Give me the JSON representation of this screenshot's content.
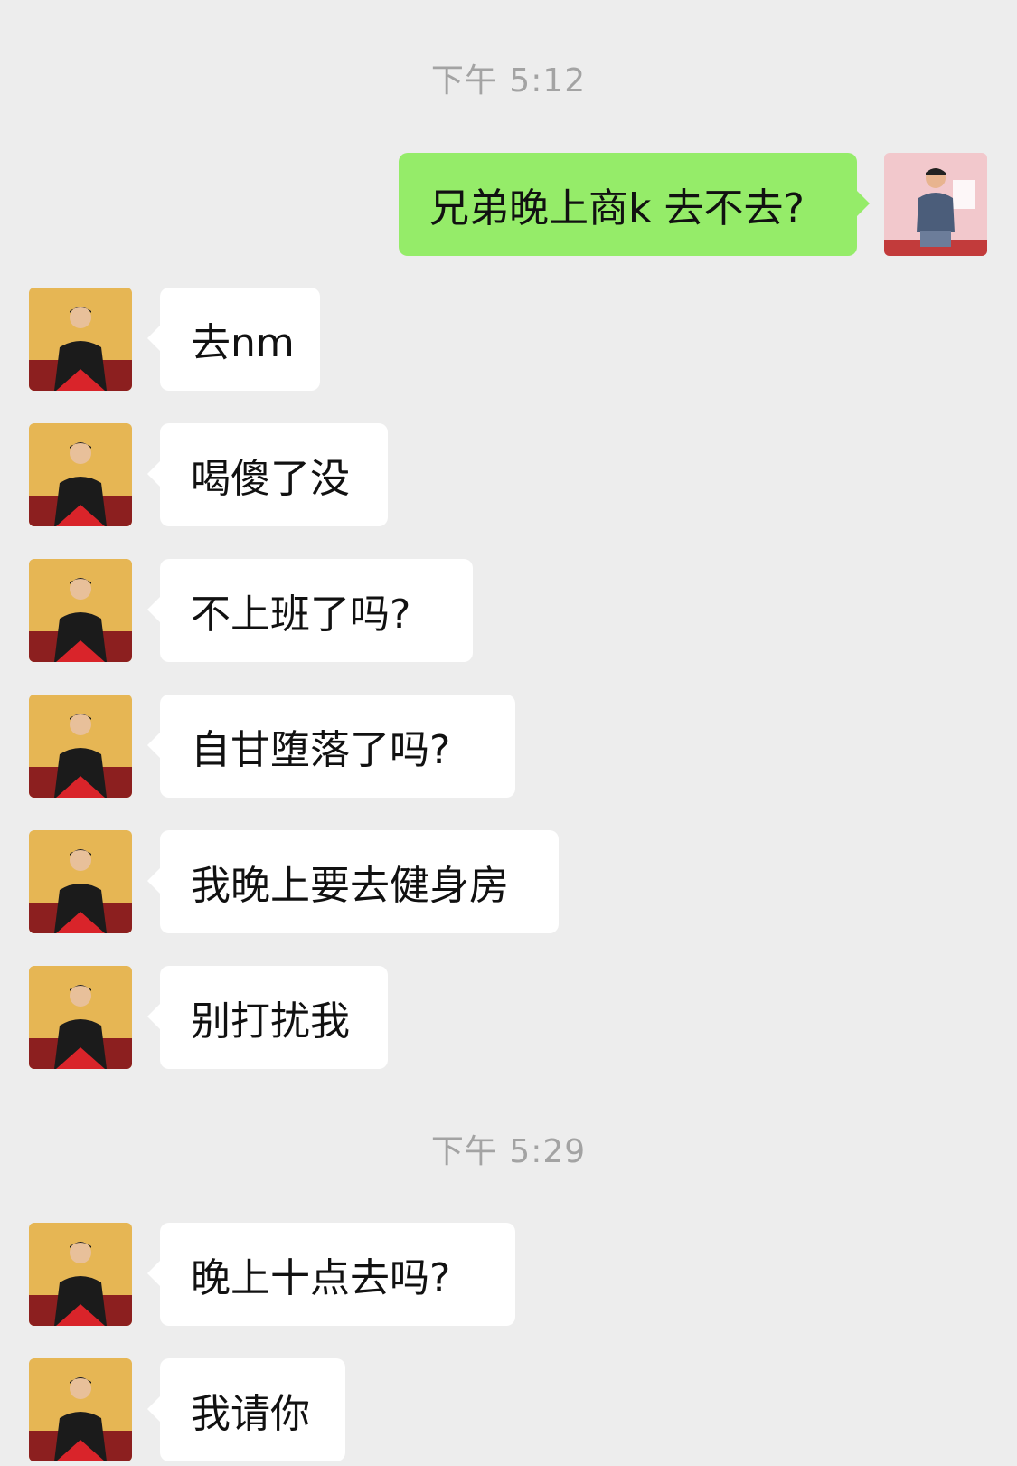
{
  "colors": {
    "background": "#ededed",
    "outgoing_bubble": "#95ec69",
    "incoming_bubble": "#ffffff",
    "timestamp": "#a3a3a3"
  },
  "timestamps": [
    "下午 5:12",
    "下午 5:29"
  ],
  "outgoing": {
    "avatar_icon": "user-photo-avatar",
    "text": "兄弟晚上商k 去不去?"
  },
  "incoming": [
    {
      "avatar_icon": "contact-photo-avatar",
      "text": "去nm"
    },
    {
      "avatar_icon": "contact-photo-avatar",
      "text": "喝傻了没"
    },
    {
      "avatar_icon": "contact-photo-avatar",
      "text": "不上班了吗?"
    },
    {
      "avatar_icon": "contact-photo-avatar",
      "text": "自甘堕落了吗?"
    },
    {
      "avatar_icon": "contact-photo-avatar",
      "text": "我晚上要去健身房"
    },
    {
      "avatar_icon": "contact-photo-avatar",
      "text": "别打扰我"
    },
    {
      "avatar_icon": "contact-photo-avatar",
      "text": "晚上十点去吗?"
    },
    {
      "avatar_icon": "contact-photo-avatar",
      "text": "我请你"
    }
  ]
}
